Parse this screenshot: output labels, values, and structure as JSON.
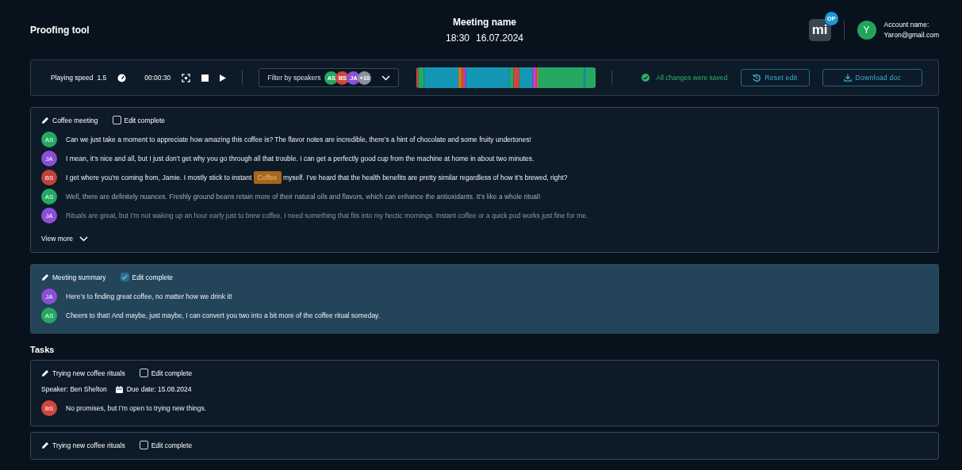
{
  "app_title": "Proofing tool",
  "meeting": {
    "name": "Meeting name",
    "time": "18:30",
    "date": "16.07.2024"
  },
  "logo": {
    "text": "mi",
    "badge": "OP"
  },
  "account": {
    "initial": "Y",
    "label": "Account name:",
    "email": "Yaron@gmail.com"
  },
  "toolbar": {
    "speed_label": "Playing speed",
    "speed_value": "1.5",
    "time": "00:00:30",
    "filter_label": "Filter by speakers",
    "filter_speakers": [
      {
        "initials": "AS",
        "color": "#27a862"
      },
      {
        "initials": "BS",
        "color": "#d0463f"
      },
      {
        "initials": "JA",
        "color": "#8b4fd6"
      },
      {
        "initials": "+10",
        "color": "#8b8f9e"
      }
    ],
    "saved_text": "All changes were saved",
    "reset_button": "Reset edit",
    "download_button": "Download doc"
  },
  "sections": [
    {
      "title": "Coffee meeting",
      "edit_complete": {
        "label": "Edit complete",
        "checked": false
      },
      "highlighted": false,
      "lines": [
        {
          "speaker": "AS",
          "color": "#27a862",
          "text": "Can we just take a moment to appreciate how amazing this coffee is? The flavor notes are incredible, there’s a hint of chocolate and some fruity undertones!"
        },
        {
          "speaker": "JA",
          "color": "#8b4fd6",
          "text": "I mean, it’s nice and all, but I just don’t get why you go through all that trouble. I can get a perfectly good cup from the machine at home in about two minutes."
        },
        {
          "speaker": "BS",
          "color": "#c0413c",
          "text_before": "I get where you’re coming from, Jamie. I mostly stick to instant",
          "mark": "Coffee",
          "text_after": "myself. I’ve heard that the health benefits are pretty similar regardless of how it’s brewed, right?"
        },
        {
          "speaker": "AS",
          "color": "#27a862",
          "text": "Well, there are definitely nuances. Freshly ground beans retain more of their natural oils and flavors, which can enhance the antioxidants. It’s like a whole ritual!"
        },
        {
          "speaker": "JA",
          "color": "#8b4fd6",
          "text": "Rituals are great, but I’m not waking up an hour early just to brew coffee. I need something that fits into my hectic mornings. Instant coffee or a quick pod works just fine for me."
        }
      ],
      "view_more": "View more"
    },
    {
      "title": "Meeting summary",
      "edit_complete": {
        "label": "Edit complete",
        "checked": true
      },
      "highlighted": true,
      "lines": [
        {
          "speaker": "JA",
          "color": "#8b4fd6",
          "text": "Here’s to finding great coffee, no matter how we drink it!"
        },
        {
          "speaker": "AS",
          "color": "#27a862",
          "text": "Cheers to that! And maybe, just maybe, I can convert you two into a bit more of the coffee ritual someday."
        }
      ]
    }
  ],
  "tasks_heading": "Tasks",
  "tasks": [
    {
      "title": "Trying new coffee rituals",
      "edit_complete": {
        "label": "Edit complete",
        "checked": false
      },
      "speaker": "Speaker: Ben Shelton",
      "due": "Due date: 15.08.2024",
      "lines": [
        {
          "speaker": "BS",
          "color": "#d0463f",
          "text": "No promises, but I’m open to trying new things."
        }
      ]
    },
    {
      "title": "Trying new coffee rituals",
      "edit_complete": {
        "label": "Edit complete",
        "checked": false
      }
    }
  ]
}
